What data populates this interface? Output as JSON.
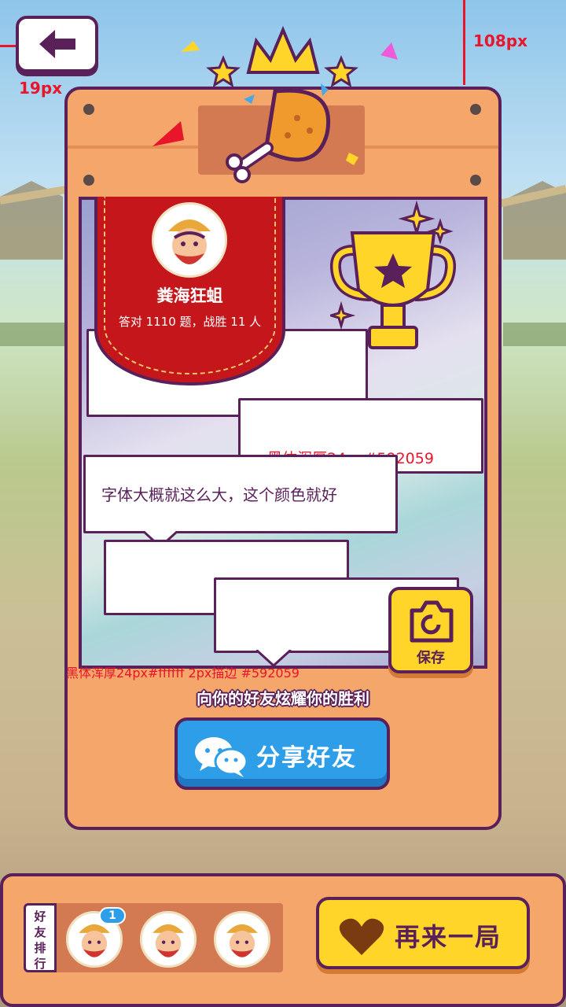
{
  "guides": {
    "back_left_offset": "19px",
    "top_offset": "108px",
    "bubble_spec_1": "黑体浑厚24px#592059",
    "bubble_spec_2": "黑体浑厚24px#ffffff  2px描边 #592059"
  },
  "player": {
    "name": "粪海狂蛆",
    "stats": "答对 1110 题，战胜 11 人"
  },
  "bubbles": {
    "main_text": "字体大概就这么大，这个颜色就好"
  },
  "save": {
    "label": "保存"
  },
  "share": {
    "note": "向你的好友炫耀你的胜利",
    "button_label": "分享好友"
  },
  "ranking": {
    "tab_label": "好友排行",
    "first_badge": "1",
    "friends": [
      "friend-1",
      "friend-2",
      "friend-3"
    ]
  },
  "again": {
    "label": "再来一局"
  },
  "colors": {
    "outline": "#592059",
    "panel": "#f5a66b",
    "ribbon": "#c5171b",
    "share_blue": "#2e9ee9",
    "button_yellow": "#ffd52a",
    "guide_red": "#e8152b"
  },
  "icons": [
    "back-arrow-icon",
    "crown-icon",
    "chicken-drumstick-icon",
    "trophy-icon",
    "camera-icon",
    "wechat-icon",
    "heart-icon"
  ]
}
